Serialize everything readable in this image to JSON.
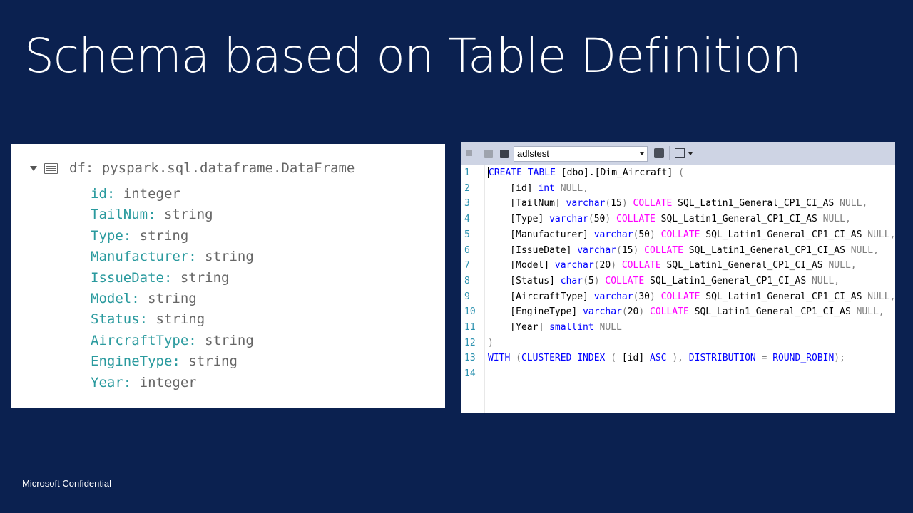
{
  "slide": {
    "title": "Schema based on Table Definition",
    "footer": "Microsoft  Confidential"
  },
  "dataframe": {
    "title": "df: pyspark.sql.dataframe.DataFrame",
    "fields": [
      {
        "name": "id:",
        "type": " integer"
      },
      {
        "name": "TailNum:",
        "type": " string"
      },
      {
        "name": "Type:",
        "type": " string"
      },
      {
        "name": "Manufacturer:",
        "type": " string"
      },
      {
        "name": "IssueDate:",
        "type": " string"
      },
      {
        "name": "Model:",
        "type": " string"
      },
      {
        "name": "Status:",
        "type": " string"
      },
      {
        "name": "AircraftType:",
        "type": " string"
      },
      {
        "name": "EngineType:",
        "type": " string"
      },
      {
        "name": "Year:",
        "type": " integer"
      }
    ]
  },
  "editor": {
    "database": "adlstest",
    "lines": [
      {
        "n": "1",
        "tokens": [
          [
            "kw",
            "CREATE TABLE"
          ],
          [
            "t",
            " [dbo].[Dim_Aircraft] "
          ],
          [
            "nl",
            "("
          ]
        ]
      },
      {
        "n": "2",
        "tokens": [
          [
            "t",
            "    [id] "
          ],
          [
            "kw",
            "int"
          ],
          [
            "t",
            " "
          ],
          [
            "nl",
            "NULL,"
          ]
        ]
      },
      {
        "n": "3",
        "tokens": [
          [
            "t",
            "    [TailNum] "
          ],
          [
            "kw",
            "varchar"
          ],
          [
            "nl",
            "("
          ],
          [
            "t",
            "15"
          ],
          [
            "nl",
            ")"
          ],
          [
            "t",
            " "
          ],
          [
            "fn",
            "COLLATE"
          ],
          [
            "t",
            " SQL_Latin1_General_CP1_CI_AS "
          ],
          [
            "nl",
            "NULL,"
          ]
        ]
      },
      {
        "n": "4",
        "tokens": [
          [
            "t",
            "    [Type] "
          ],
          [
            "kw",
            "varchar"
          ],
          [
            "nl",
            "("
          ],
          [
            "t",
            "50"
          ],
          [
            "nl",
            ")"
          ],
          [
            "t",
            " "
          ],
          [
            "fn",
            "COLLATE"
          ],
          [
            "t",
            " SQL_Latin1_General_CP1_CI_AS "
          ],
          [
            "nl",
            "NULL,"
          ]
        ]
      },
      {
        "n": "5",
        "tokens": [
          [
            "t",
            "    [Manufacturer] "
          ],
          [
            "kw",
            "varchar"
          ],
          [
            "nl",
            "("
          ],
          [
            "t",
            "50"
          ],
          [
            "nl",
            ")"
          ],
          [
            "t",
            " "
          ],
          [
            "fn",
            "COLLATE"
          ],
          [
            "t",
            " SQL_Latin1_General_CP1_CI_AS "
          ],
          [
            "nl",
            "NULL,"
          ]
        ]
      },
      {
        "n": "6",
        "tokens": [
          [
            "t",
            "    [IssueDate] "
          ],
          [
            "kw",
            "varchar"
          ],
          [
            "nl",
            "("
          ],
          [
            "t",
            "15"
          ],
          [
            "nl",
            ")"
          ],
          [
            "t",
            " "
          ],
          [
            "fn",
            "COLLATE"
          ],
          [
            "t",
            " SQL_Latin1_General_CP1_CI_AS "
          ],
          [
            "nl",
            "NULL,"
          ]
        ]
      },
      {
        "n": "7",
        "tokens": [
          [
            "t",
            "    [Model] "
          ],
          [
            "kw",
            "varchar"
          ],
          [
            "nl",
            "("
          ],
          [
            "t",
            "20"
          ],
          [
            "nl",
            ")"
          ],
          [
            "t",
            " "
          ],
          [
            "fn",
            "COLLATE"
          ],
          [
            "t",
            " SQL_Latin1_General_CP1_CI_AS "
          ],
          [
            "nl",
            "NULL,"
          ]
        ]
      },
      {
        "n": "8",
        "tokens": [
          [
            "t",
            "    [Status] "
          ],
          [
            "kw",
            "char"
          ],
          [
            "nl",
            "("
          ],
          [
            "t",
            "5"
          ],
          [
            "nl",
            ")"
          ],
          [
            "t",
            " "
          ],
          [
            "fn",
            "COLLATE"
          ],
          [
            "t",
            " SQL_Latin1_General_CP1_CI_AS "
          ],
          [
            "nl",
            "NULL,"
          ]
        ]
      },
      {
        "n": "9",
        "tokens": [
          [
            "t",
            "    [AircraftType] "
          ],
          [
            "kw",
            "varchar"
          ],
          [
            "nl",
            "("
          ],
          [
            "t",
            "30"
          ],
          [
            "nl",
            ")"
          ],
          [
            "t",
            " "
          ],
          [
            "fn",
            "COLLATE"
          ],
          [
            "t",
            " SQL_Latin1_General_CP1_CI_AS "
          ],
          [
            "nl",
            "NULL,"
          ]
        ]
      },
      {
        "n": "10",
        "tokens": [
          [
            "t",
            "    [EngineType] "
          ],
          [
            "kw",
            "varchar"
          ],
          [
            "nl",
            "("
          ],
          [
            "t",
            "20"
          ],
          [
            "nl",
            ")"
          ],
          [
            "t",
            " "
          ],
          [
            "fn",
            "COLLATE"
          ],
          [
            "t",
            " SQL_Latin1_General_CP1_CI_AS "
          ],
          [
            "nl",
            "NULL,"
          ]
        ]
      },
      {
        "n": "11",
        "tokens": [
          [
            "t",
            "    [Year] "
          ],
          [
            "kw",
            "smallint"
          ],
          [
            "t",
            " "
          ],
          [
            "nl",
            "NULL"
          ]
        ]
      },
      {
        "n": "12",
        "tokens": [
          [
            "nl",
            ")"
          ]
        ]
      },
      {
        "n": "13",
        "tokens": [
          [
            "kw",
            "WITH"
          ],
          [
            "t",
            " "
          ],
          [
            "nl",
            "("
          ],
          [
            "kw",
            "CLUSTERED INDEX"
          ],
          [
            "t",
            " "
          ],
          [
            "nl",
            "("
          ],
          [
            "t",
            " [id] "
          ],
          [
            "kw",
            "ASC"
          ],
          [
            "t",
            " "
          ],
          [
            "nl",
            "),"
          ],
          [
            "t",
            " "
          ],
          [
            "kw",
            "DISTRIBUTION"
          ],
          [
            "t",
            " "
          ],
          [
            "nl",
            "="
          ],
          [
            "t",
            " "
          ],
          [
            "kw",
            "ROUND_ROBIN"
          ],
          [
            "nl",
            ");"
          ]
        ]
      },
      {
        "n": "14",
        "tokens": []
      }
    ]
  }
}
